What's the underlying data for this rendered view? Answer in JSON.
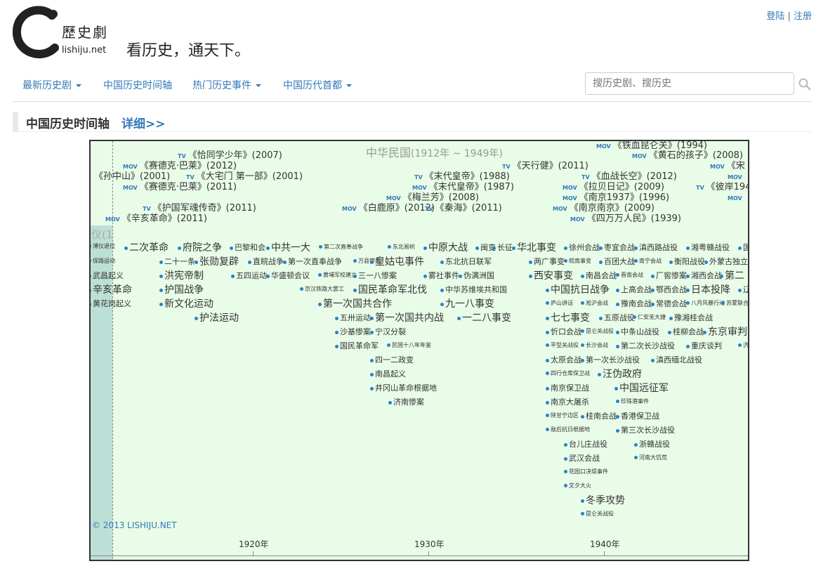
{
  "header": {
    "site_name": "lishiju.net",
    "logo_text": "歷史劇",
    "slogan": "看历史，通天下。",
    "login": "登陆",
    "separator": "|",
    "register": "注册"
  },
  "nav": {
    "items": [
      {
        "label": "最新历史剧",
        "dropdown": true
      },
      {
        "label": "中国历史时间轴",
        "dropdown": false
      },
      {
        "label": "热门历史事件",
        "dropdown": true
      },
      {
        "label": "中国历代首都",
        "dropdown": true
      }
    ],
    "search_placeholder": "搜历史剧、搜历史"
  },
  "section": {
    "title": "中国历史时间轴",
    "more": "详细>>"
  },
  "timeline": {
    "era": "中华民国",
    "era_range": "(1912年 ~ 1949年)",
    "qing_partial": "仪(1",
    "copyright": "© 2013 LISHIJU.NET",
    "axis_labels": [
      "1920年",
      "1930年",
      "1940年"
    ],
    "media": [
      {
        "tag": "MOV",
        "title": "《铁血昆仑关》(1994)"
      },
      {
        "tag": "TV",
        "title": "《恰同学少年》(2007)"
      },
      {
        "tag": "MOV",
        "title": "《黄石的孩子》(2008)"
      },
      {
        "tag": "MOV",
        "title": "《赛德克·巴莱》(2012)"
      },
      {
        "tag": "TV",
        "title": "《天行健》(2011)"
      },
      {
        "tag": "MOV",
        "title": "《宋"
      },
      {
        "tag": "",
        "title": "《孙中山》(2001)"
      },
      {
        "tag": "TV",
        "title": "《大宅门 第一部》(2001)"
      },
      {
        "tag": "TV",
        "title": "《末代皇帝》(1988)"
      },
      {
        "tag": "TV",
        "title": "《血战长空》(2012)"
      },
      {
        "tag": "MOV",
        "title": ""
      },
      {
        "tag": "MOV",
        "title": "《赛德克·巴莱》(2011)"
      },
      {
        "tag": "MOV",
        "title": "《末代皇帝》(1987)"
      },
      {
        "tag": "MOV",
        "title": "《拉贝日记》(2009)"
      },
      {
        "tag": "TV",
        "title": "《彼岸194"
      },
      {
        "tag": "MOV",
        "title": "《梅兰芳》(2008)"
      },
      {
        "tag": "MOV",
        "title": "《南京1937》(1996)"
      },
      {
        "tag": "MOV",
        "title": ""
      },
      {
        "tag": "TV",
        "title": "《护国军魂传奇》(2011)"
      },
      {
        "tag": "MOV",
        "title": "《白鹿原》(2012)"
      },
      {
        "tag": "TV",
        "title": "《秦海》(2011)"
      },
      {
        "tag": "MOV",
        "title": "《南京南京》(2009)"
      },
      {
        "tag": "MOV",
        "title": "《辛亥革命》(2011)"
      },
      {
        "tag": "MOV",
        "title": "《四万万人民》(1939)"
      }
    ],
    "events": [
      "溥仪退位",
      "二次革命",
      "府院之争",
      "巴黎和会",
      "中共一大",
      "第二次直奉战争",
      "东北易帜",
      "中原大战",
      "闽变",
      "长征",
      "华北事变",
      "徐州会战",
      "枣宜会战",
      "滇西路战役",
      "湘粤赣战役",
      "国",
      "保路运动",
      "二十一条",
      "张勋复辟",
      "直皖战争",
      "第一次直奉战争",
      "万县惨案",
      "皇姑屯事件",
      "东北抗日联军",
      "两广事变",
      "皖南事变",
      "百团大战",
      "南宁会战",
      "衡阳战役",
      "外蒙古独立",
      "武昌起义",
      "洪宪帝制",
      "五四运动",
      "华盛顿会议",
      "黄埔军校建立",
      "三一八惨案",
      "雾社事件",
      "伪满洲国",
      "西安事变",
      "南昌会战",
      "晋南会战",
      "厂窖惨案",
      "湘西会战",
      "第二",
      "辛亥革命",
      "护国战争",
      "京汉铁路大罢工",
      "国民革命军北伐",
      "中华苏维埃共和国",
      "中国抗日战争",
      "上高会战",
      "鄂西会战",
      "日本投降",
      "辽",
      "黄花岗起义",
      "新文化运动",
      "第一次国共合作",
      "九一八事变",
      "庐山讲话",
      "淞沪会战",
      "豫南会战",
      "常德会战",
      "八月风暴行动",
      "苏蒙联合",
      "护法运动",
      "五卅运动",
      "第一次国共内战",
      "一二八事变",
      "七七事变",
      "五原战役",
      "仁安羌大捷",
      "豫湘桂会战",
      "沙基惨案",
      "宁汉分裂",
      "忻口会战",
      "昆仑关战役",
      "中条山战役",
      "桂柳会战",
      "东京审判",
      "国民革命军",
      "民国十八年年鉴",
      "平型关战役",
      "长沙会战",
      "第二次长沙战役",
      "重庆谈判",
      "济",
      "四一二政变",
      "太原会战",
      "第一次长沙战役",
      "滇西缅北战役",
      "南昌起义",
      "四行仓库保卫战",
      "汪伪政府",
      "井冈山革命根据地",
      "南京保卫战",
      "中国远征军",
      "济南惨案",
      "南京大屠杀",
      "珍珠港事件",
      "陕甘宁边区",
      "桂南会战",
      "香港保卫战",
      "敌后抗日根据地",
      "第三次长沙战役",
      "台儿庄战役",
      "浙赣战役",
      "武汉会战",
      "河南大饥荒",
      "花园口决堤事件",
      "文夕大火",
      "冬季攻势",
      "昆仑关战役"
    ]
  }
}
